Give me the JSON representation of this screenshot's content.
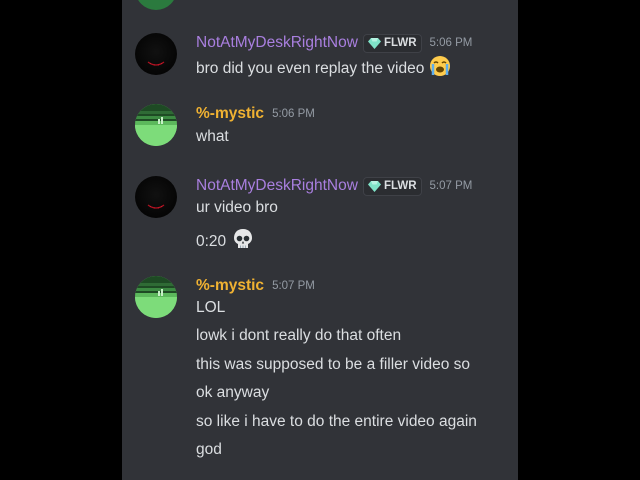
{
  "top_stub": {
    "text": "..."
  },
  "messages": [
    {
      "author": "NotAtMyDeskRightNow",
      "tag": "FLWR",
      "time": "5:06 PM",
      "lines": [
        "bro did you even replay the video"
      ]
    },
    {
      "author": "%-mystic",
      "time": "5:06 PM",
      "lines": [
        "what"
      ]
    },
    {
      "author": "NotAtMyDeskRightNow",
      "tag": "FLWR",
      "time": "5:07 PM",
      "lines": [
        "ur video bro",
        "0:20"
      ]
    },
    {
      "author": "%-mystic",
      "time": "5:07 PM",
      "lines": [
        "LOL",
        "lowk i dont really do that often",
        "this was supposed to be a filler video so",
        "ok anyway",
        "so like i have to do the entire video again",
        "god"
      ]
    }
  ],
  "icons": {
    "tag": "diamond-icon",
    "emoji_1": "loudly-crying-face-icon",
    "emoji_2": "skull-icon"
  },
  "colors": {
    "background": "#313338",
    "author_purple": "#a97fdf",
    "author_gold": "#f0b232",
    "text": "#dbdee1",
    "timestamp": "#949ba4"
  }
}
